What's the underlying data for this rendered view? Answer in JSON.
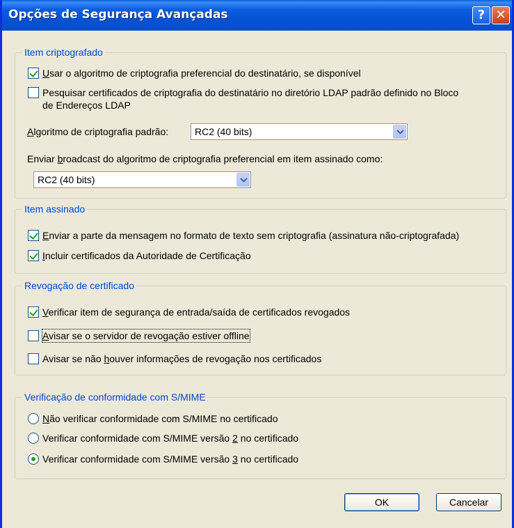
{
  "window": {
    "title": "Opções de Segurança Avançadas",
    "help_glyph": "?",
    "close_glyph": "✕"
  },
  "encrypted": {
    "label": "Item criptografado",
    "opt_pref_algo": {
      "underline": "U",
      "rest": "sar o algoritmo de criptografia preferencial do destinatário, se disponível",
      "checked": true
    },
    "opt_ldap": {
      "line1": "Pesquisar certificados de criptografia do destinatário no diretório LDAP padrão definido no Bloco",
      "line2": "de Endereços LDAP",
      "checked": false
    },
    "default_algo_label": {
      "underline": "A",
      "rest": "lgoritmo de criptografia padrão:"
    },
    "default_algo_value": "RC2 (40 bits)",
    "broadcast_label": {
      "pre": "Enviar ",
      "underline": "b",
      "rest": "roadcast do algoritmo de criptografia preferencial em item assinado como:"
    },
    "broadcast_value": "RC2 (40 bits)"
  },
  "signed": {
    "label": "Item assinado",
    "opt_cleartext": {
      "underline": "E",
      "rest": "nviar a parte da mensagem  no formato de texto sem criptografia (assinatura não-criptografada)",
      "checked": true
    },
    "opt_include_ca": {
      "underline": "I",
      "rest": "ncluir certificados da Autoridade de Certificação",
      "checked": true
    }
  },
  "revocation": {
    "label": "Revogação de certificado",
    "opt_check": {
      "underline": "V",
      "rest": "erificar item de segurança de entrada/saída de certificados revogados",
      "checked": true
    },
    "opt_offline": {
      "underline": "A",
      "rest": "visar se o servidor de revogação estiver offline",
      "checked": false
    },
    "opt_no_info": {
      "pre": "Avisar se não ",
      "underline": "h",
      "rest": "ouver informações de revogação nos certificados",
      "checked": false
    }
  },
  "smime": {
    "label": "Verificação de conformidade com S/MIME",
    "radio_none": {
      "underline": "N",
      "rest": "ão verificar conformidade com S/MIME no certificado",
      "selected": false
    },
    "radio_v2": {
      "pre": "Verificar conformidade com  S/MIME versão ",
      "underline": "2",
      "rest": " no certificado",
      "selected": false
    },
    "radio_v3": {
      "pre": "Verificar conformidade com  S/MIME versão ",
      "underline": "3",
      "rest": " no certificado",
      "selected": true
    }
  },
  "buttons": {
    "ok": "OK",
    "cancel": "Cancelar"
  }
}
